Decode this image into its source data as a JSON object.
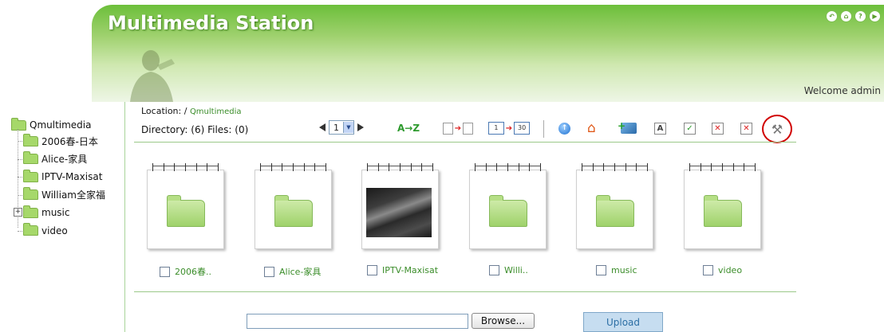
{
  "header": {
    "title": "Multimedia Station",
    "welcome": "Welcome admin"
  },
  "location": {
    "label": "Location: /",
    "path": "Qmultimedia"
  },
  "directory_info": "Directory: (6) Files: (0)",
  "pager": {
    "page": "1"
  },
  "toolbar": {
    "sort_label": "A→Z",
    "cal_from": "1",
    "cal_to": "30"
  },
  "tree": {
    "root": "Qmultimedia",
    "items": [
      {
        "label": "2006春-日本"
      },
      {
        "label": "Alice-家具"
      },
      {
        "label": "IPTV-Maxisat"
      },
      {
        "label": "William全家福"
      },
      {
        "label": "music"
      },
      {
        "label": "video"
      }
    ]
  },
  "folders": [
    {
      "caption": "2006春.."
    },
    {
      "caption": "Alice-家具"
    },
    {
      "caption": "IPTV-Maxisat"
    },
    {
      "caption": "Willi.."
    },
    {
      "caption": "music"
    },
    {
      "caption": "video"
    }
  ],
  "upload": {
    "browse_label": "Browse...",
    "upload_label": "Upload"
  }
}
